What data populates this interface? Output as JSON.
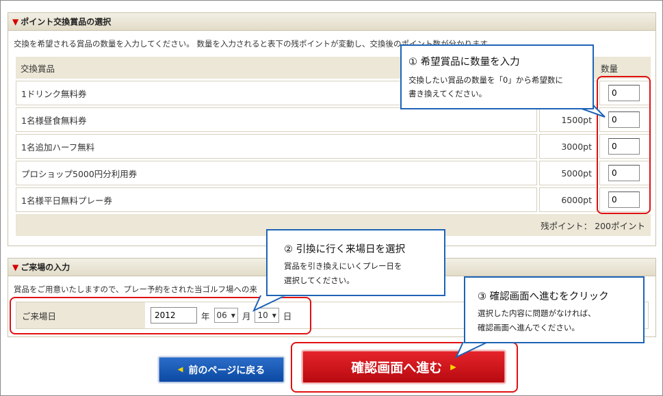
{
  "section_points": {
    "title": "ポイント交換賞品の選択",
    "description": "交換を希望される賞品の数量を入力してください。 数量を入力されると表下の残ポイントが変動し、交換後のポイント数が分かります。",
    "columns": {
      "item": "交換賞品",
      "qty": "数量"
    },
    "rows": [
      {
        "name": "1ドリンク無料券",
        "points": "",
        "qty": "0"
      },
      {
        "name": "1名様昼食無料券",
        "points": "1500pt",
        "qty": "0"
      },
      {
        "name": "1名追加ハーフ無料",
        "points": "3000pt",
        "qty": "0"
      },
      {
        "name": "プロショップ5000円分利用券",
        "points": "5000pt",
        "qty": "0"
      },
      {
        "name": "1名様平日無料プレー券",
        "points": "6000pt",
        "qty": "0"
      }
    ],
    "remaining": "残ポイント： 200ポイント"
  },
  "section_visit": {
    "title": "ご来場の入力",
    "description": "賞品をご用意いたしますので、プレー予約をされた当ゴルフ場への来",
    "label": "ご来場日",
    "year": "2012",
    "year_unit": "年",
    "month": "06",
    "month_unit": "月",
    "day": "10",
    "day_unit": "日"
  },
  "buttons": {
    "back": "前のページに戻る",
    "confirm": "確認画面へ進む"
  },
  "callouts": {
    "c1": {
      "title": "① 希望賞品に数量を入力",
      "line1": "交換したい賞品の数量を「0」から希望数に",
      "line2": "書き換えてください。"
    },
    "c2": {
      "title": "② 引換に行く来場日を選択",
      "line1": "賞品を引き換えにいくプレー日を",
      "line2": "選択してください。"
    },
    "c3": {
      "title": "③ 確認画面へ進むをクリック",
      "line1": "選択した内容に問題がなければ、",
      "line2": "確認画面へ進んでください。"
    }
  },
  "colors": {
    "accent_red": "#e01010",
    "callout_blue": "#1d63b6",
    "header_beige": "#ece7d6"
  }
}
